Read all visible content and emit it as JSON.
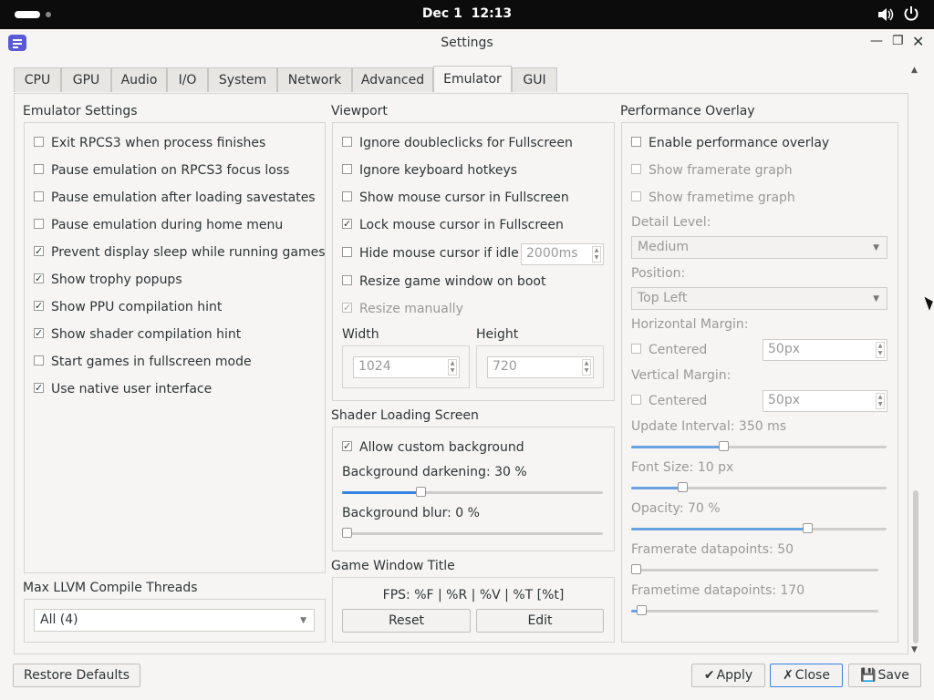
{
  "topbar": {
    "date": "Dec 1",
    "time": "12:13"
  },
  "window": {
    "title": "Settings"
  },
  "tabs": [
    "CPU",
    "GPU",
    "Audio",
    "I/O",
    "System",
    "Network",
    "Advanced",
    "Emulator",
    "GUI"
  ],
  "emulator_settings": {
    "title": "Emulator Settings",
    "items": [
      {
        "label": "Exit RPCS3 when process finishes",
        "checked": false
      },
      {
        "label": "Pause emulation on RPCS3 focus loss",
        "checked": false
      },
      {
        "label": "Pause emulation after loading savestates",
        "checked": false
      },
      {
        "label": "Pause emulation during home menu",
        "checked": false
      },
      {
        "label": "Prevent display sleep while running games",
        "checked": true
      },
      {
        "label": "Show trophy popups",
        "checked": true
      },
      {
        "label": "Show PPU compilation hint",
        "checked": true
      },
      {
        "label": "Show shader compilation hint",
        "checked": true
      },
      {
        "label": "Start games in fullscreen mode",
        "checked": false
      },
      {
        "label": "Use native user interface",
        "checked": true
      }
    ]
  },
  "llvm": {
    "title": "Max LLVM Compile Threads",
    "value": "All (4)"
  },
  "viewport": {
    "title": "Viewport",
    "items": [
      {
        "label": "Ignore doubleclicks for Fullscreen",
        "checked": false
      },
      {
        "label": "Ignore keyboard hotkeys",
        "checked": false
      },
      {
        "label": "Show mouse cursor in Fullscreen",
        "checked": false
      },
      {
        "label": "Lock mouse cursor in Fullscreen",
        "checked": true
      },
      {
        "label": "Hide mouse cursor if idle",
        "checked": false
      },
      {
        "label": "Resize game window on boot",
        "checked": false
      },
      {
        "label": "Resize manually",
        "checked": true
      }
    ],
    "idle_ms": "2000ms",
    "width_label": "Width",
    "width_value": "1024",
    "height_label": "Height",
    "height_value": "720"
  },
  "shader_loading": {
    "title": "Shader Loading Screen",
    "allow_custom_bg": "Allow custom background",
    "allow_custom_bg_checked": true,
    "darkening_label": "Background darkening: 30 %",
    "darkening_value": 30,
    "blur_label": "Background blur: 0 %",
    "blur_value": 0
  },
  "game_window_title": {
    "title": "Game Window Title",
    "format": "FPS: %F | %R | %V | %T [%t]",
    "reset": "Reset",
    "edit": "Edit"
  },
  "perf_overlay": {
    "title": "Performance Overlay",
    "enable": "Enable performance overlay",
    "enable_checked": false,
    "framerate_graph": "Show framerate graph",
    "frametime_graph": "Show frametime graph",
    "detail_level_label": "Detail Level:",
    "detail_level": "Medium",
    "position_label": "Position:",
    "position": "Top Left",
    "h_margin_label": "Horizontal Margin:",
    "h_centered": "Centered",
    "h_margin": "50px",
    "v_margin_label": "Vertical Margin:",
    "v_centered": "Centered",
    "v_margin": "50px",
    "update_interval_label": "Update Interval: 350 ms",
    "update_interval_fraction": 0.36,
    "font_size_label": "Font Size: 10 px",
    "font_size_fraction": 0.2,
    "opacity_label": "Opacity: 70 %",
    "opacity_fraction": 0.69,
    "framerate_dp_label": "Framerate datapoints: 50",
    "framerate_dp_fraction": 0.0,
    "frametime_dp_label": "Frametime datapoints: 170",
    "frametime_dp_fraction": 0.04
  },
  "footer": {
    "restore": "Restore Defaults",
    "apply": "Apply",
    "close": "Close",
    "save": "Save"
  },
  "colors": {
    "accent": "#3584e4",
    "topbar": "#0c0c0c"
  }
}
